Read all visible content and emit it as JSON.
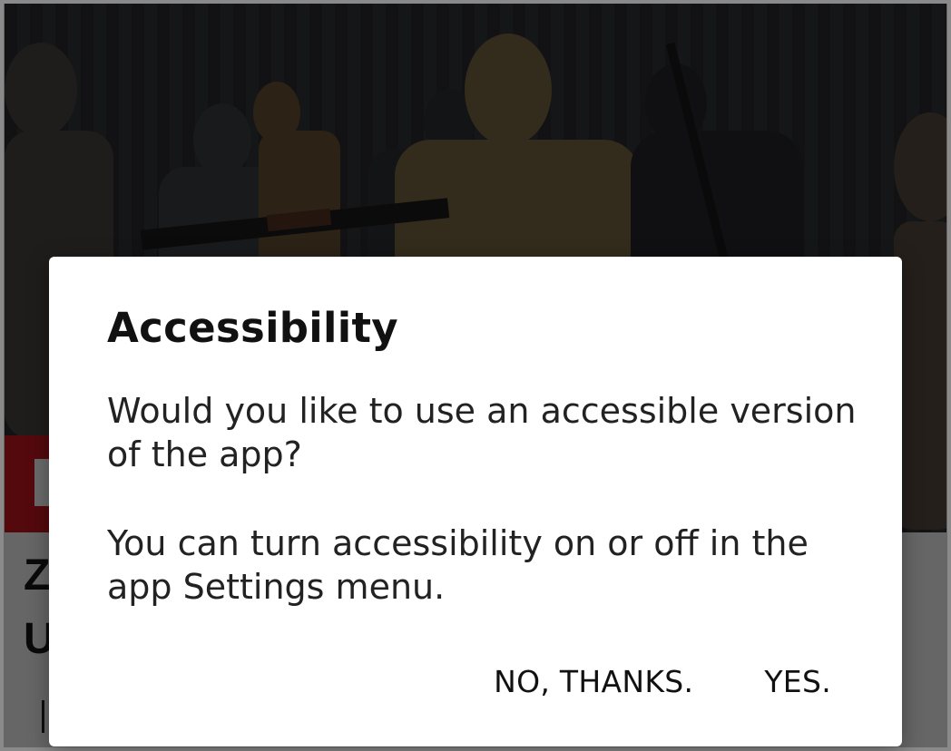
{
  "background": {
    "headline": "Z\nU",
    "category_color": "#c8171f"
  },
  "dialog": {
    "title": "Accessibility",
    "message": "Would you like to use an accessible version of the app?",
    "note": "You can turn accessibility on or off in the app Settings menu.",
    "buttons": {
      "decline": "NO, THANKS.",
      "accept": "YES."
    }
  }
}
